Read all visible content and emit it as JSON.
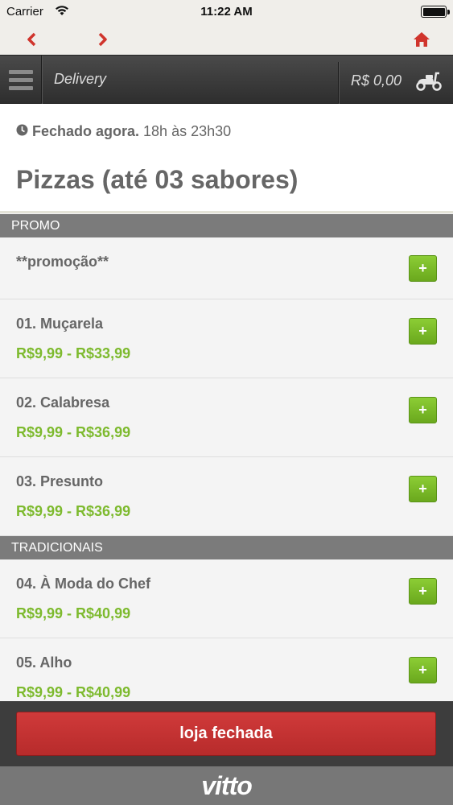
{
  "status_bar": {
    "carrier": "Carrier",
    "time": "11:22 AM"
  },
  "nav": {
    "back_icon": "chevron-left-icon",
    "forward_icon": "chevron-right-icon",
    "home_icon": "home-icon",
    "accent_color": "#d0342c"
  },
  "header": {
    "menu_icon": "hamburger-menu-icon",
    "title": "Delivery",
    "cart_total": "R$ 0,00",
    "cart_icon": "scooter-icon"
  },
  "store": {
    "status": "Fechado agora.",
    "hours": "18h às 23h30",
    "category_title": "Pizzas (até 03 sabores)"
  },
  "sections": [
    {
      "name": "PROMO",
      "items": [
        {
          "name": "**promoção**",
          "price": "",
          "button": "+"
        },
        {
          "name": "01. Muçarela",
          "price": "R$9,99 - R$33,99",
          "button": "+"
        },
        {
          "name": "02. Calabresa",
          "price": "R$9,99 - R$36,99",
          "button": "+"
        },
        {
          "name": "03. Presunto",
          "price": "R$9,99 - R$36,99",
          "button": "+"
        }
      ]
    },
    {
      "name": "TRADICIONAIS",
      "items": [
        {
          "name": "04. À Moda do Chef",
          "price": "R$9,99 - R$40,99",
          "button": "+"
        },
        {
          "name": "05. Alho",
          "price": "R$9,99 - R$40,99",
          "button": "+"
        }
      ]
    }
  ],
  "bottom": {
    "closed_label": "loja fechada",
    "logo": "vitto"
  },
  "colors": {
    "price_green": "#7dba2e",
    "closed_red": "#c53131",
    "header_dark": "#3a3a3a"
  }
}
